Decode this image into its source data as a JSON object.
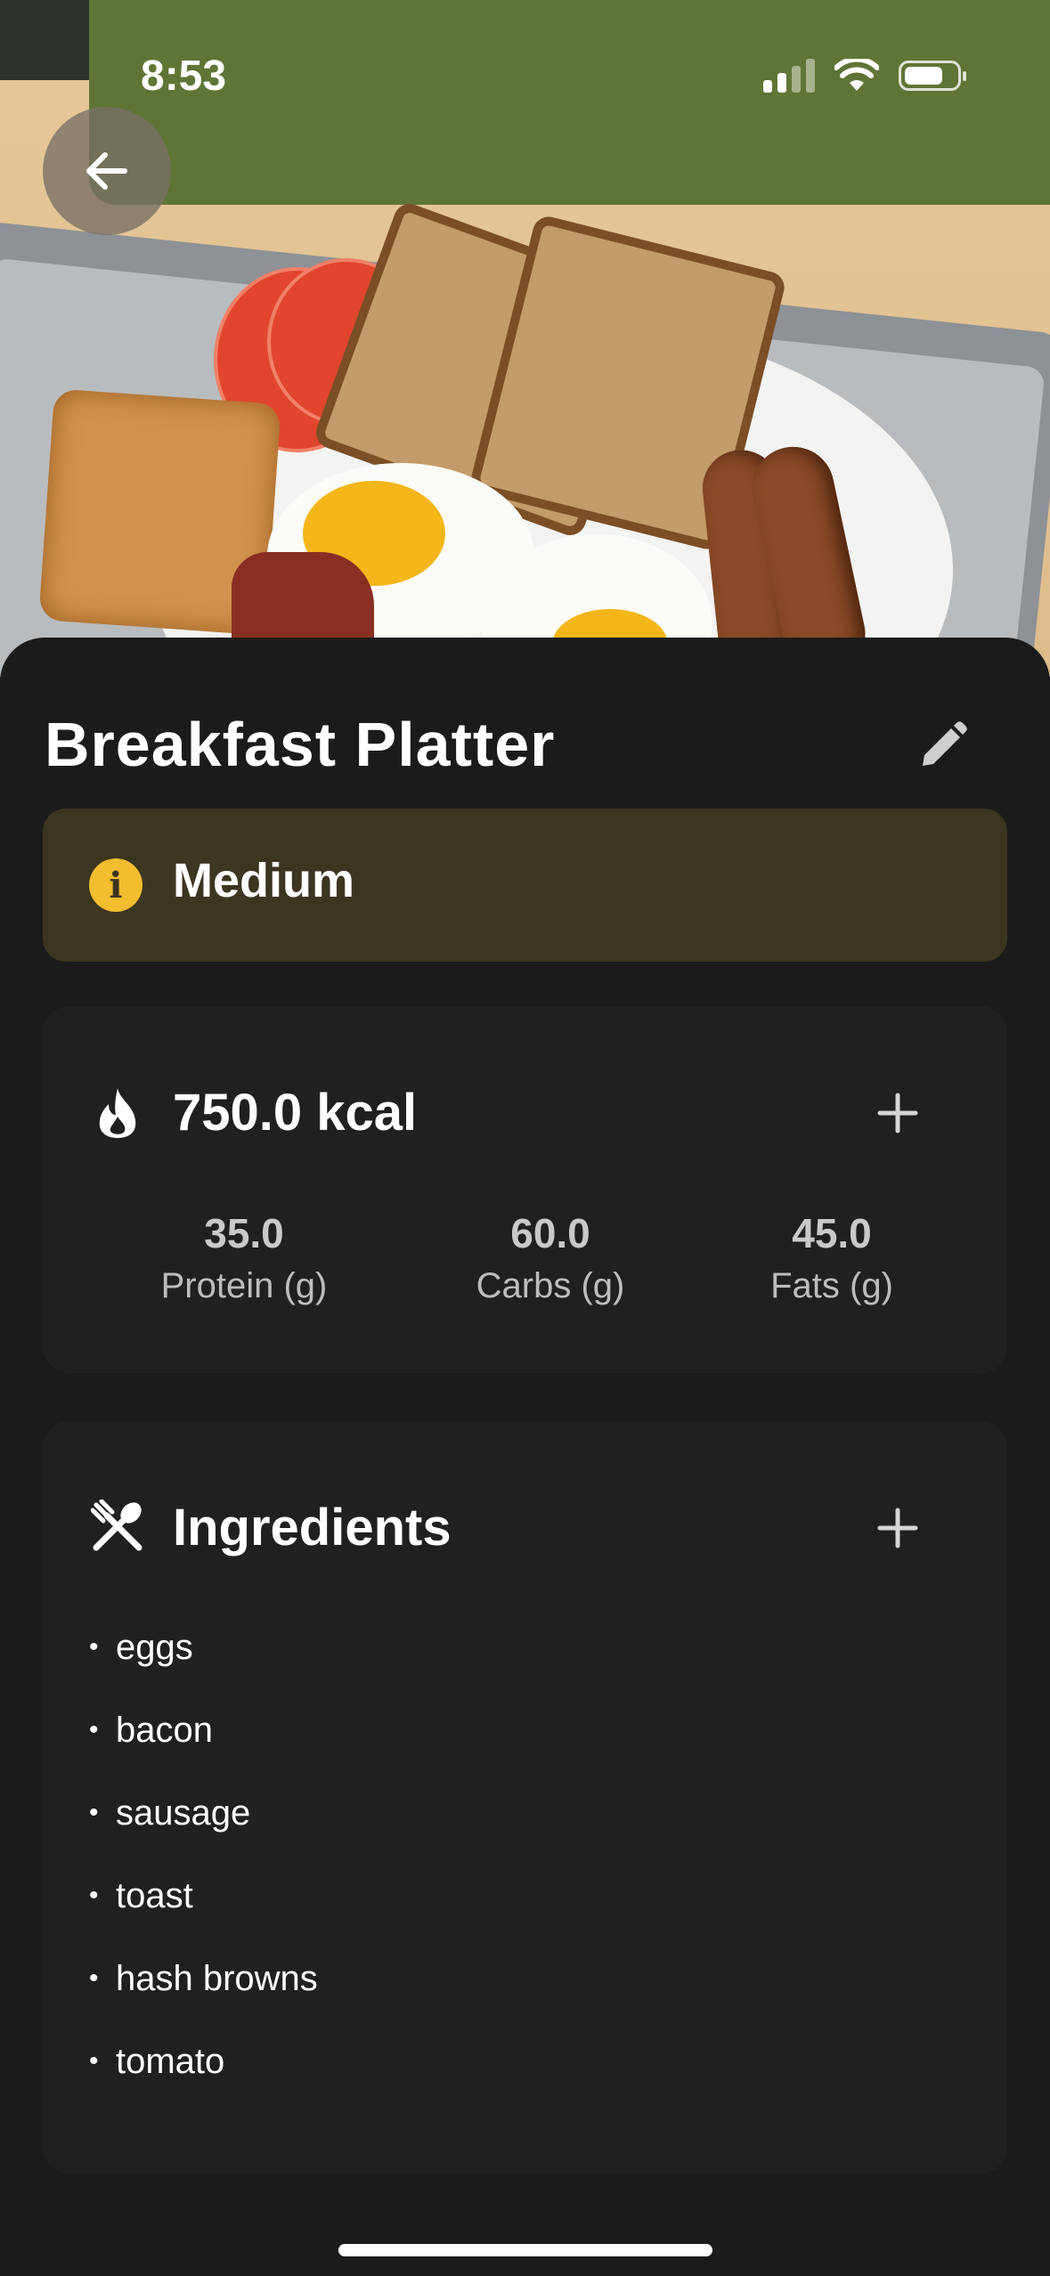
{
  "status_bar": {
    "time": "8:53",
    "icons": [
      "cellular-signal-icon",
      "wifi-icon",
      "battery-icon"
    ]
  },
  "header": {
    "back_icon": "arrow-left-icon",
    "photo_alt": "Breakfast platter photo"
  },
  "meal": {
    "title": "Breakfast Platter",
    "edit_icon": "pencil-icon"
  },
  "level": {
    "icon": "info-icon",
    "label": "Medium",
    "colors": {
      "background": "#3c3520",
      "icon": "#f2bd2f"
    }
  },
  "calories": {
    "icon": "flame-icon",
    "value": "750.0 kcal",
    "add_icon": "plus-icon",
    "macros": [
      {
        "value": "35.0",
        "label": "Protein (g)"
      },
      {
        "value": "60.0",
        "label": "Carbs (g)"
      },
      {
        "value": "45.0",
        "label": "Fats (g)"
      }
    ]
  },
  "ingredients": {
    "icon": "utensils-icon",
    "title": "Ingredients",
    "add_icon": "plus-icon",
    "items": [
      "eggs",
      "bacon",
      "sausage",
      "toast",
      "hash browns",
      "tomato"
    ]
  }
}
